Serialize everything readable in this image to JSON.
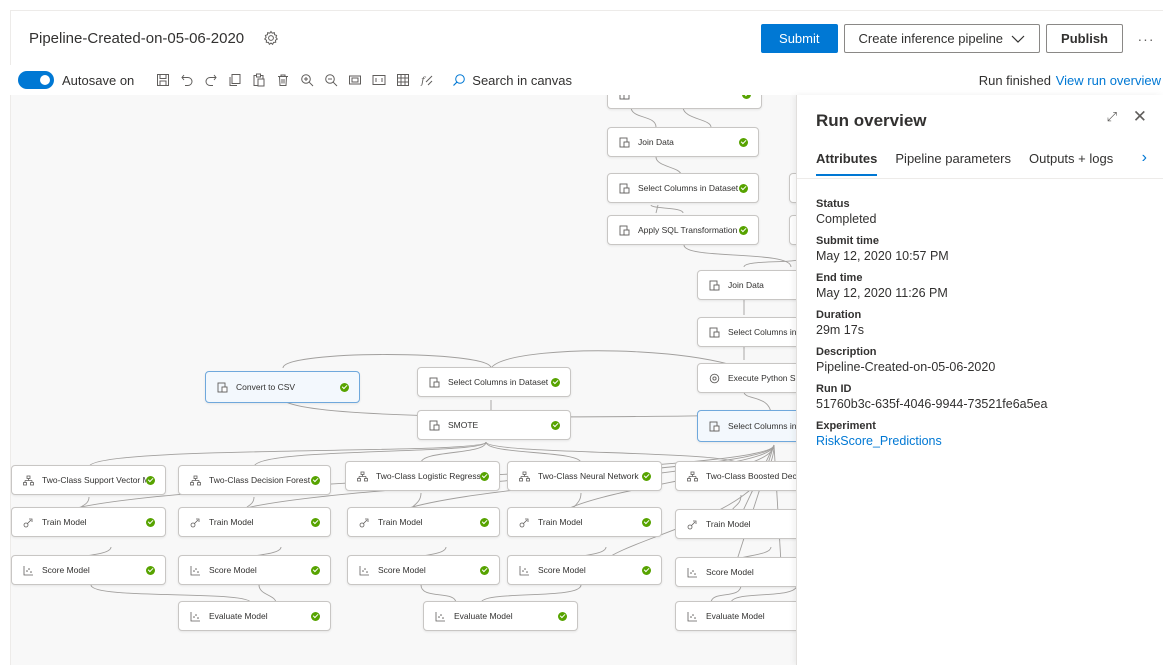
{
  "header": {
    "title": "Pipeline-Created-on-05-06-2020",
    "submit_label": "Submit",
    "inference_label": "Create inference pipeline",
    "publish_label": "Publish",
    "more_label": "···"
  },
  "toolbar": {
    "autosave_label": "Autosave on",
    "search_placeholder": "Search in canvas",
    "run_status": "Run finished",
    "run_link": "View run overview"
  },
  "canvas": {
    "nodes": [
      {
        "id": "data-top",
        "label": "",
        "icon": "dataset-icon"
      },
      {
        "id": "join-data-1",
        "label": "Join Data",
        "icon": "dataset-icon"
      },
      {
        "id": "select-cols-1",
        "label": "Select Columns in Dataset",
        "icon": "dataset-icon"
      },
      {
        "id": "apply-sql",
        "label": "Apply SQL Transformation",
        "icon": "dataset-icon"
      },
      {
        "id": "join-data-2",
        "label": "Join Data",
        "icon": "dataset-icon"
      },
      {
        "id": "select-cols-2",
        "label": "Select Columns in Da",
        "icon": "dataset-icon"
      },
      {
        "id": "exec-python",
        "label": "Execute Python Scrip",
        "icon": "script-icon"
      },
      {
        "id": "convert-csv",
        "label": "Convert to CSV",
        "icon": "dataset-icon"
      },
      {
        "id": "select-cols-3",
        "label": "Select Columns in Dataset",
        "icon": "dataset-icon"
      },
      {
        "id": "smote",
        "label": "SMOTE",
        "icon": "dataset-icon"
      },
      {
        "id": "select-cols-4",
        "label": "Select Columns in Da",
        "icon": "dataset-icon"
      },
      {
        "id": "svm",
        "label": "Two-Class Support Vector Ma...",
        "icon": "algorithm-icon"
      },
      {
        "id": "forest",
        "label": "Two-Class Decision Forest",
        "icon": "algorithm-icon"
      },
      {
        "id": "logreg",
        "label": "Two-Class Logistic Regression",
        "icon": "algorithm-icon"
      },
      {
        "id": "nn",
        "label": "Two-Class Neural Network",
        "icon": "algorithm-icon"
      },
      {
        "id": "boosted",
        "label": "Two-Class Boosted Decisio",
        "icon": "algorithm-icon"
      },
      {
        "id": "train-1",
        "label": "Train Model",
        "icon": "train-icon"
      },
      {
        "id": "train-2",
        "label": "Train Model",
        "icon": "train-icon"
      },
      {
        "id": "train-3",
        "label": "Train Model",
        "icon": "train-icon"
      },
      {
        "id": "train-4",
        "label": "Train Model",
        "icon": "train-icon"
      },
      {
        "id": "train-5",
        "label": "Train Model",
        "icon": "train-icon"
      },
      {
        "id": "score-1",
        "label": "Score Model",
        "icon": "score-icon"
      },
      {
        "id": "score-2",
        "label": "Score Model",
        "icon": "score-icon"
      },
      {
        "id": "score-3",
        "label": "Score Model",
        "icon": "score-icon"
      },
      {
        "id": "score-4",
        "label": "Score Model",
        "icon": "score-icon"
      },
      {
        "id": "score-5",
        "label": "Score Model",
        "icon": "score-icon"
      },
      {
        "id": "eval-1",
        "label": "Evaluate Model",
        "icon": "score-icon"
      },
      {
        "id": "eval-2",
        "label": "Evaluate Model",
        "icon": "score-icon"
      },
      {
        "id": "eval-3",
        "label": "Evaluate Model",
        "icon": "score-icon"
      }
    ]
  },
  "panel": {
    "title": "Run overview",
    "tabs": [
      "Attributes",
      "Pipeline parameters",
      "Outputs + logs"
    ],
    "attributes": [
      {
        "label": "Status",
        "value": "Completed"
      },
      {
        "label": "Submit time",
        "value": "May 12, 2020 10:57 PM"
      },
      {
        "label": "End time",
        "value": "May 12, 2020 11:26 PM"
      },
      {
        "label": "Duration",
        "value": "29m 17s"
      },
      {
        "label": "Description",
        "value": "Pipeline-Created-on-05-06-2020"
      },
      {
        "label": "Run ID",
        "value": "51760b3c-635f-4046-9944-73521fe6a5ea"
      },
      {
        "label": "Experiment",
        "value": "RiskScore_Predictions"
      }
    ]
  }
}
